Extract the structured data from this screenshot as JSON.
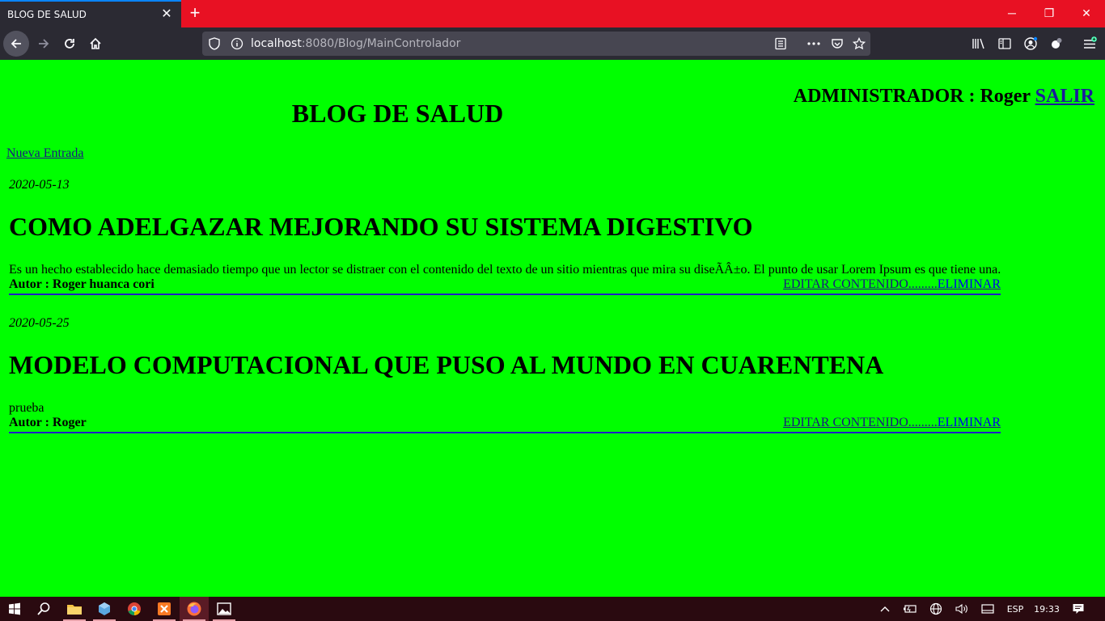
{
  "browser": {
    "tab_title": "BLOG DE SALUD",
    "tab_close": "✕",
    "new_tab": "+",
    "window": {
      "minimize": "─",
      "maximize": "❐",
      "close": "✕"
    },
    "url_host": "localhost",
    "url_path": ":8080/Blog/MainControlador",
    "colors": {
      "tabbar": "#e81123",
      "toolbar": "#2b2a33",
      "urlbar": "#474651"
    }
  },
  "page": {
    "background": "#00ff00",
    "blog_title": "BLOG DE SALUD",
    "admin_label": "ADMINISTRADOR : Roger",
    "logout_link": "SALIR",
    "new_entry_link": "Nueva Entrada",
    "posts": [
      {
        "date": "2020-05-13",
        "title": "COMO ADELGAZAR MEJORANDO SU SISTEMA DIGESTIVO",
        "body": "Es un hecho establecido hace demasiado tiempo que un lector se distraer con el contenido del texto de un sitio mientras que mira su diseÃÂ±o. El punto de usar Lorem Ipsum es que tiene una.",
        "author": "Autor : Roger huanca cori",
        "edit_link": "EDITAR CONTENIDO.........",
        "delete_link": "ELIMINAR"
      },
      {
        "date": "2020-05-25",
        "title": "MODELO COMPUTACIONAL QUE PUSO AL MUNDO EN CUARENTENA",
        "body": "prueba",
        "author": "Autor : Roger",
        "edit_link": "EDITAR CONTENIDO.........",
        "delete_link": "ELIMINAR"
      }
    ]
  },
  "taskbar": {
    "language": "ESP",
    "time": "19:33"
  }
}
